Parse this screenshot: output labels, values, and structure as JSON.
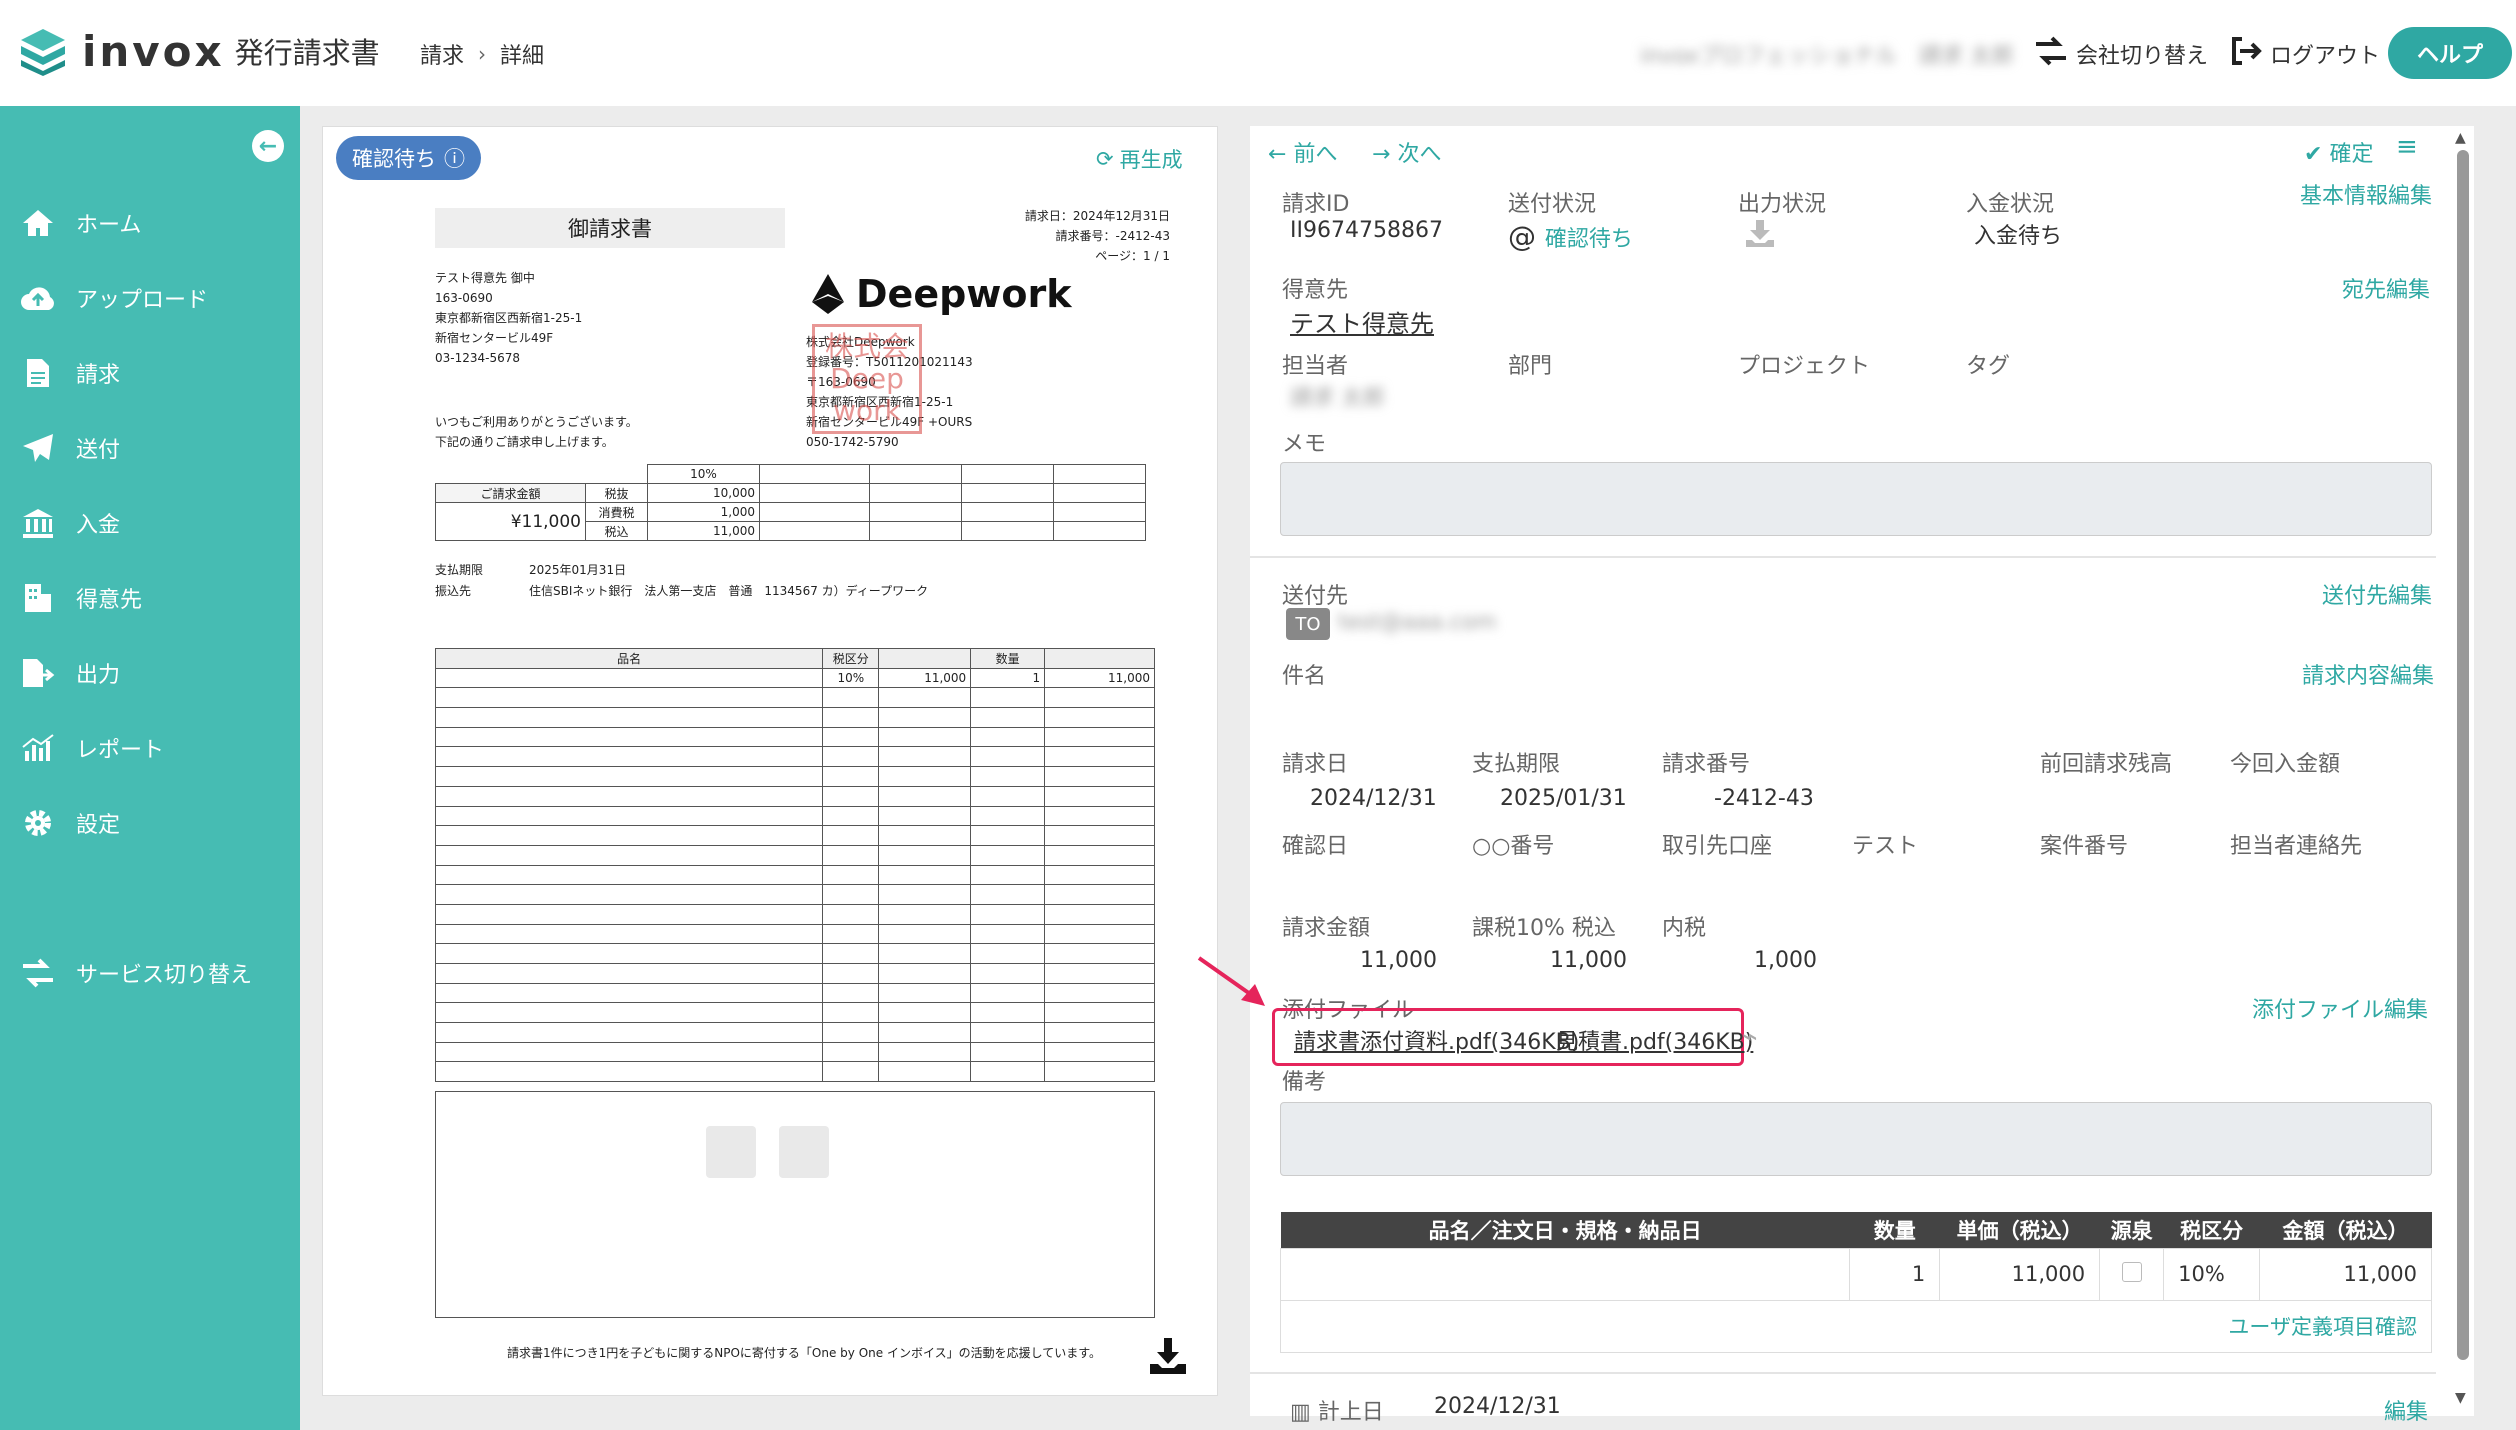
{
  "app": {
    "logo_text": "invox",
    "logo_sub": "発行請求書"
  },
  "breadcrumb": {
    "item1": "請求",
    "separator": "›",
    "item2": "詳細"
  },
  "header": {
    "user_blurred": "invoxプロフェッショナル　請求 太郎",
    "switch_company": "会社切り替え",
    "logout": "ログアウト",
    "help": "ヘルプ"
  },
  "sidebar": {
    "home": "ホーム",
    "upload": "アップロード",
    "invoice": "請求",
    "send": "送付",
    "payment": "入金",
    "customers": "得意先",
    "output": "出力",
    "report": "レポート",
    "settings": "設定",
    "service_switch": "サービス切り替え"
  },
  "preview": {
    "status": "確認待ち",
    "regenerate": "再生成",
    "title": "御請求書",
    "meta_date": "請求日：2024年12月31日",
    "meta_number": "請求番号：-2412-43",
    "meta_page": "ページ：1 / 1",
    "addr1": "テスト得意先 御中",
    "addr2": "163-0690",
    "addr3": "東京都新宿区西新宿1-25-1",
    "addr4": "新宿センタービル49F",
    "addr5": "03-1234-5678",
    "greet1": "いつもご利用ありがとうございます。",
    "greet2": "下記の通りご請求申し上げます。",
    "company_logo": "Deepwork",
    "c1": "株式会社Deepwork",
    "c2": "登録番号：T5011201021143",
    "c3": "〒163-0690",
    "c4": "東京都新宿区西新宿1-25-1",
    "c5": "新宿センタービル49F +OURS",
    "c6": "050-1742-5790",
    "stamp1": "株式会",
    "stamp2": "Deep",
    "stamp3": "work",
    "sum_rate": "10%",
    "sum_label": "ご請求金額",
    "sum_amount": "¥11,000",
    "tax_ex_label": "税抜",
    "tax_label": "消費税",
    "tax_in_label": "税込",
    "tax_ex": "10,000",
    "tax": "1,000",
    "tax_in": "11,000",
    "due_label": "支払期限",
    "due": "2025年01月31日",
    "bank_label": "振込先",
    "bank": "住信SBIネット銀行　法人第一支店　普通　1134567 カ）ディープワーク",
    "col_name": "品名",
    "col_tax": "税区分",
    "col_qty": "数量",
    "row_tax": "10%",
    "row_price": "11,000",
    "row_qty": "1",
    "row_amount": "11,000",
    "footer": "請求書1件につき1円を子どもに関するNPOに寄付する「One by One インボイス」の活動を応援しています。"
  },
  "detail": {
    "prev": "前へ",
    "next": "次へ",
    "confirm": "確定",
    "invoice_id_label": "請求ID",
    "invoice_id": "II9674758867",
    "send_status_label": "送付状況",
    "send_status": "確認待ち",
    "output_status_label": "出力状況",
    "payment_status_label": "入金状況",
    "payment_status": "入金待ち",
    "basic_edit": "基本情報編集",
    "customer_label": "得意先",
    "customer": "テスト得意先",
    "dest_edit": "宛先編集",
    "person_label": "担当者",
    "person_blurred": "請求 太郎",
    "dept_label": "部門",
    "project_label": "プロジェクト",
    "tag_label": "タグ",
    "memo_label": "メモ",
    "send_to_label": "送付先",
    "send_to_edit": "送付先編集",
    "to_badge": "TO",
    "send_to_blurred": "test@aaa.com",
    "subject_label": "件名",
    "content_edit": "請求内容編集",
    "inv_date_label": "請求日",
    "inv_date": "2024/12/31",
    "due_label": "支払期限",
    "due": "2025/01/31",
    "inv_no_label": "請求番号",
    "inv_no": "-2412-43",
    "prev_balance_label": "前回請求残高",
    "this_payment_label": "今回入金額",
    "confirm_date_label": "確認日",
    "oo_label": "○○番号",
    "bank_label": "取引先口座",
    "test_label": "テスト",
    "case_label": "案件番号",
    "contact_label": "担当者連絡先",
    "amount_label": "請求金額",
    "taxable_label": "課税10% 税込",
    "inner_tax_label": "内税",
    "amount": "11,000",
    "taxable": "11,000",
    "inner_tax": "1,000",
    "attach_label": "添付ファイル",
    "attach_edit": "添付ファイル編集",
    "attach1": "請求書添付資料.pdf(346KB)",
    "attach2": "見積書.pdf(346KB)",
    "remarks_label": "備考",
    "th_name": "品名／注文日・規格・納品日",
    "th_qty": "数量",
    "th_price": "単価（税込）",
    "th_withhold": "源泉",
    "th_tax": "税区分",
    "th_amount": "金額（税込）",
    "line_qty": "1",
    "line_price": "11,000",
    "line_tax": "10%",
    "line_amount": "11,000",
    "user_field_check": "ユーザ定義項目確認",
    "record_date_label": "計上日",
    "record_date": "2024/12/31",
    "edit": "編集"
  }
}
